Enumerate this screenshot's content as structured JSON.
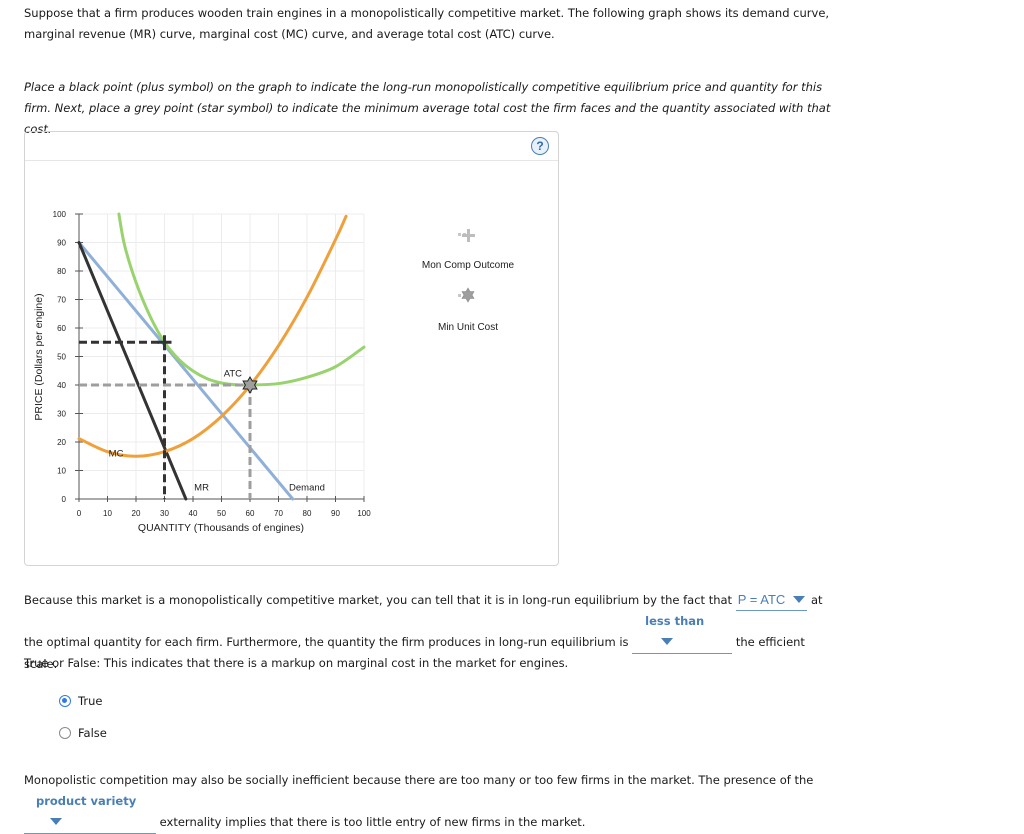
{
  "intro_text": "Suppose that a firm produces wooden train engines in a monopolistically competitive market. The following graph shows its demand curve, marginal revenue (MR) curve, marginal cost (MC) curve, and average total cost (ATC) curve.",
  "instructions": "Place a black point (plus symbol) on the graph to indicate the long-run monopolistically competitive equilibrium price and quantity for this firm. Next, place a grey point (star symbol) to indicate the minimum average total cost the firm faces and the quantity associated with that cost.",
  "help_icon": "?",
  "palette": {
    "items": [
      {
        "label": "Mon Comp Outcome",
        "icon": "plus-icon",
        "color": "#bdbdbd"
      },
      {
        "label": "Min Unit Cost",
        "icon": "star-icon",
        "color": "#9e9e9e"
      }
    ]
  },
  "chart_data": {
    "type": "line",
    "xlabel": "QUANTITY (Thousands of engines)",
    "ylabel": "PRICE (Dollars per engine)",
    "xlim": [
      0,
      100
    ],
    "ylim": [
      0,
      100
    ],
    "xticks": [
      0,
      10,
      20,
      30,
      40,
      50,
      60,
      70,
      80,
      90,
      100
    ],
    "yticks": [
      0,
      10,
      20,
      30,
      40,
      50,
      60,
      70,
      80,
      90,
      100
    ],
    "grid": true,
    "series": [
      {
        "name": "Demand",
        "color": "#8fb0d8",
        "points": [
          [
            0,
            90
          ],
          [
            75,
            0
          ]
        ],
        "label_at": [
          80,
          3
        ]
      },
      {
        "name": "MR",
        "color": "#333333",
        "points": [
          [
            0,
            90
          ],
          [
            37.5,
            0
          ]
        ],
        "label_at": [
          43,
          3
        ]
      },
      {
        "name": "MC",
        "color": "#f0a03a",
        "points": [
          [
            0,
            21.2
          ],
          [
            10,
            16.6
          ],
          [
            20,
            15
          ],
          [
            30,
            16.6
          ],
          [
            40,
            21.2
          ],
          [
            50,
            29
          ],
          [
            60,
            39.8
          ],
          [
            70,
            53.8
          ],
          [
            80,
            70.8
          ],
          [
            90,
            91
          ],
          [
            93.7,
            99.2
          ]
        ],
        "label_at": [
          13,
          15
        ]
      },
      {
        "name": "ATC",
        "color": "#99d36e",
        "points": [
          [
            14,
            100
          ],
          [
            16,
            89
          ],
          [
            20,
            76
          ],
          [
            25,
            64
          ],
          [
            30,
            55
          ],
          [
            35,
            49
          ],
          [
            40,
            44.9
          ],
          [
            45,
            42.2
          ],
          [
            50,
            40.7
          ],
          [
            55,
            40.1
          ],
          [
            60,
            40
          ],
          [
            70,
            40.5
          ],
          [
            80,
            42.7
          ],
          [
            90,
            46.4
          ],
          [
            100,
            53.3
          ]
        ],
        "label_at": [
          54,
          43
        ]
      }
    ],
    "markers": [
      {
        "name": "Mon Comp Outcome",
        "symbol": "plus",
        "x": 30,
        "y": 55,
        "color": "#333333",
        "guides": true
      },
      {
        "name": "Min Unit Cost",
        "symbol": "star",
        "x": 60,
        "y": 40,
        "color": "#9e9e9e",
        "guides": true
      }
    ]
  },
  "q1": {
    "before": "Because this market is a monopolistically competitive market, you can tell that it is in long-run equilibrium by the fact that ",
    "dropdown1": "P = ATC",
    "middle": " at the optimal quantity for each firm. Furthermore, the quantity the firm produces in long-run equilibrium is ",
    "dropdown2": "less than",
    "after": " the efficient scale."
  },
  "q2": {
    "question": "True or False: This indicates that there is a markup on marginal cost in the market for engines.",
    "options": [
      {
        "label": "True",
        "selected": true
      },
      {
        "label": "False",
        "selected": false
      }
    ]
  },
  "q3": {
    "before": "Monopolistic competition may also be socially inefficient because there are too many or too few firms in the market. The presence of the",
    "dropdown": "product variety",
    "after": " externality implies that there is too little entry of new firms in the market."
  }
}
